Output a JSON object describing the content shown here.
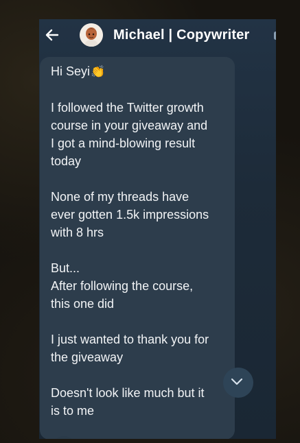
{
  "header": {
    "contact_name": "Michael | Copywriter",
    "back_icon": "arrow-left-icon",
    "avatar_icon": "avatar"
  },
  "message": {
    "greeting": "Hi Seyi",
    "greeting_emoji": "👏",
    "body": "I followed the Twitter growth\ncourse in your giveaway and\nI got a mind-blowing result\ntoday\n\nNone of my threads have\never gotten 1.5k impressions\nwith 8 hrs\n\nBut...\nAfter following the course,\nthis one did\n\nI just wanted to thank you for\nthe giveaway\n\nDoesn't look like much but it\nis to me"
  },
  "colors": {
    "chat_background": "#1f2d3b",
    "bubble": "#2d3d4c",
    "text": "#f2f4f6"
  },
  "controls": {
    "scroll_down_icon": "chevron-down-icon"
  }
}
